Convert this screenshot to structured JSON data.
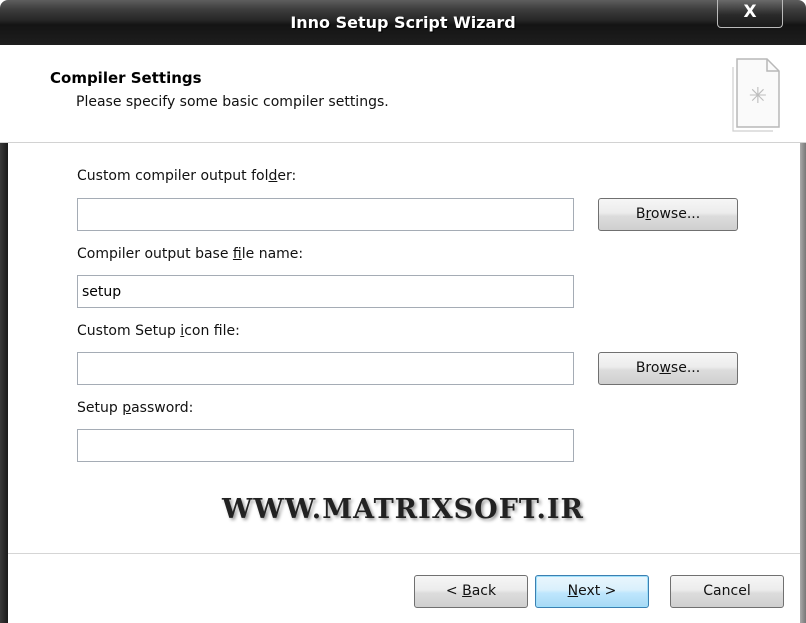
{
  "window": {
    "title": "Inno Setup Script Wizard",
    "close_label": "X"
  },
  "header": {
    "title": "Compiler Settings",
    "subtitle": "Please specify some basic compiler settings.",
    "icon": "wizard-page-icon"
  },
  "fields": {
    "output_folder": {
      "label_pre": "Custom compiler output fol",
      "label_key": "d",
      "label_post": "er:",
      "value": ""
    },
    "base_filename": {
      "label_pre": "Compiler output base ",
      "label_key": "f",
      "label_post": "ile name:",
      "value": "setup"
    },
    "icon_file": {
      "label_pre": "Custom Setup ",
      "label_key": "i",
      "label_post": "con file:",
      "value": ""
    },
    "password": {
      "label_pre": "Setup ",
      "label_key": "p",
      "label_post": "assword:",
      "value": ""
    }
  },
  "buttons": {
    "browse1": {
      "pre": "B",
      "key": "r",
      "post": "owse..."
    },
    "browse2": {
      "pre": "Bro",
      "key": "w",
      "post": "se..."
    },
    "back": {
      "pre": "< ",
      "key": "B",
      "post": "ack"
    },
    "next": {
      "pre": "",
      "key": "N",
      "post": "ext >"
    },
    "cancel": {
      "label": "Cancel"
    }
  },
  "watermark": "WWW.MATRIXSOFT.IR"
}
